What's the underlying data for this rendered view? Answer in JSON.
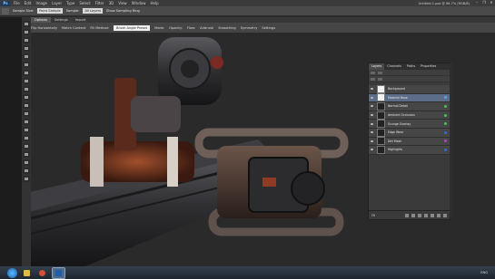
{
  "app": {
    "logo": "Ps",
    "menu": [
      "File",
      "Edit",
      "Image",
      "Layer",
      "Type",
      "Select",
      "Filter",
      "3D",
      "View",
      "Window",
      "Help"
    ],
    "title": "Untitled-1.psd @ 66.7% (RGB/8)",
    "window_buttons": [
      "–",
      "❐",
      "✕"
    ]
  },
  "options_bar": {
    "items": [
      "Sample Size:",
      "Point Sample",
      "Sample:",
      "All Layers",
      "Show Sampling Ring"
    ]
  },
  "tabs": [
    {
      "label": "Options",
      "active": true
    },
    {
      "label": "Settings",
      "active": false
    },
    {
      "label": "Import",
      "active": false
    }
  ],
  "options3d": {
    "items": [
      "Flip Horizontally",
      "Match Content",
      "Fill Method:",
      "Mode:",
      "Opacity:",
      "Flow:",
      "Airbrush",
      "Smoothing",
      "Symmetry",
      "Settings"
    ],
    "preset": "Brush Angle Preset"
  },
  "layers_panel": {
    "tabs": [
      {
        "label": "Layers",
        "active": true
      },
      {
        "label": "Channels",
        "active": false
      },
      {
        "label": "Paths",
        "active": false
      },
      {
        "label": "Properties",
        "active": false
      }
    ],
    "layers": [
      {
        "name": "Background",
        "thumb": "white",
        "selected": false,
        "color": ""
      },
      {
        "name": "Material Base",
        "thumb": "white",
        "selected": true,
        "color": "#5aa0e8"
      },
      {
        "name": "Normal Detail",
        "thumb": "dark",
        "selected": false,
        "color": "#47c25a"
      },
      {
        "name": "Ambient Occlusion",
        "thumb": "dark",
        "selected": false,
        "color": "#47c25a"
      },
      {
        "name": "Grunge Overlay",
        "thumb": "dark",
        "selected": false,
        "color": "#47c25a"
      },
      {
        "name": "Edge Wear",
        "thumb": "dark",
        "selected": false,
        "color": "#3b64d8"
      },
      {
        "name": "Dirt Mask",
        "thumb": "dark",
        "selected": false,
        "color": "#b043c8"
      },
      {
        "name": "Highlights",
        "thumb": "dark",
        "selected": false,
        "color": "#3b64d8"
      }
    ],
    "footer": "Fill"
  },
  "taskbar": {
    "tray": "ENG"
  },
  "colors": {
    "selection": "#5b6d89",
    "panel": "#3a3a3a",
    "canvas": "#2a2a2a"
  }
}
